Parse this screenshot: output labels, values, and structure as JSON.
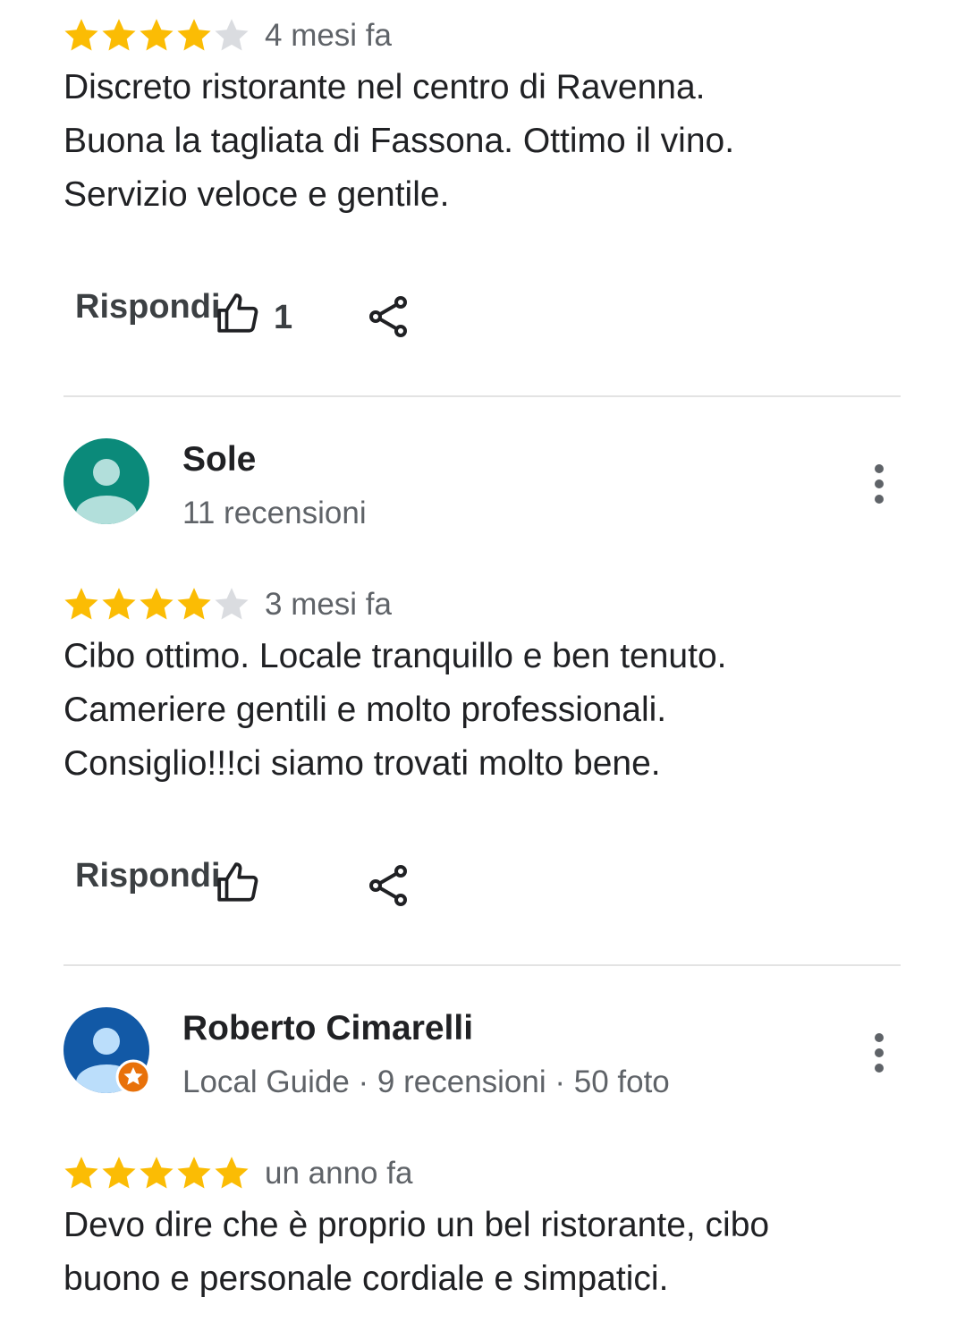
{
  "colors": {
    "star_filled": "#FBBC04",
    "star_empty": "#DADCE0",
    "avatar_teal": "#0B8A7A",
    "avatar_blue": "#1259A6",
    "local_guide_badge": "#E8710A"
  },
  "reviews": [
    {
      "rating": 4,
      "time": "4 mesi fa",
      "text_lines": [
        "Discreto ristorante nel centro di Ravenna.",
        "Buona la tagliata di Fassona. Ottimo il vino.",
        "Servizio veloce e gentile."
      ],
      "reply_label": "Rispondi",
      "like_icon": "thumbs-up-icon",
      "like_count": "1",
      "share_icon": "share-icon"
    },
    {
      "author": "Sole",
      "author_meta": "11 recensioni",
      "avatar_icon": "person-icon",
      "rating": 4,
      "time": "3 mesi fa",
      "text_lines": [
        "Cibo ottimo. Locale tranquillo e ben tenuto.",
        "Cameriere gentili e molto professionali.",
        "Consiglio!!!ci siamo trovati molto bene."
      ],
      "reply_label": "Rispondi",
      "like_icon": "thumbs-up-icon",
      "share_icon": "share-icon",
      "menu_icon": "more-vert-icon"
    },
    {
      "author": "Roberto Cimarelli",
      "author_meta": "Local Guide · 9 recensioni · 50 foto",
      "avatar_icon": "person-icon",
      "badge_icon": "local-guide-star-icon",
      "rating": 5,
      "time": "un anno fa",
      "text_lines": [
        "Devo dire che è proprio un bel ristorante, cibo",
        "buono e personale cordiale e simpatici."
      ],
      "menu_icon": "more-vert-icon"
    }
  ]
}
